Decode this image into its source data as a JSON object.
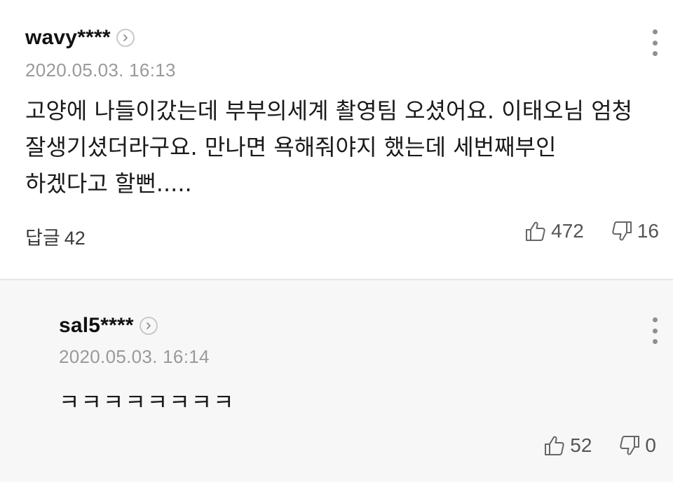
{
  "comments": [
    {
      "username": "wavy****",
      "timestamp": "2020.05.03. 16:13",
      "content": "고양에 나들이갔는데 부부의세계 촬영팀 오셨어요. 이태오님 엄청 잘생기셨더라구요. 만나면 욕해줘야지 했는데 세번째부인 하겠다고 할뻔.....",
      "reply_label": "답글",
      "reply_count": "42",
      "likes": "472",
      "dislikes": "16"
    }
  ],
  "replies": [
    {
      "username": "sal5****",
      "timestamp": "2020.05.03. 16:14",
      "content": "ㅋㅋㅋㅋㅋㅋㅋㅋ",
      "likes": "52",
      "dislikes": "0"
    }
  ],
  "icons": {
    "profile": "chevron-right-icon",
    "more": "more-vertical-icon",
    "like": "thumbs-up-icon",
    "dislike": "thumbs-down-icon"
  },
  "colors": {
    "text": "#1a1a1a",
    "muted": "#9a9a9a",
    "reply_background": "#f7f7f7"
  }
}
